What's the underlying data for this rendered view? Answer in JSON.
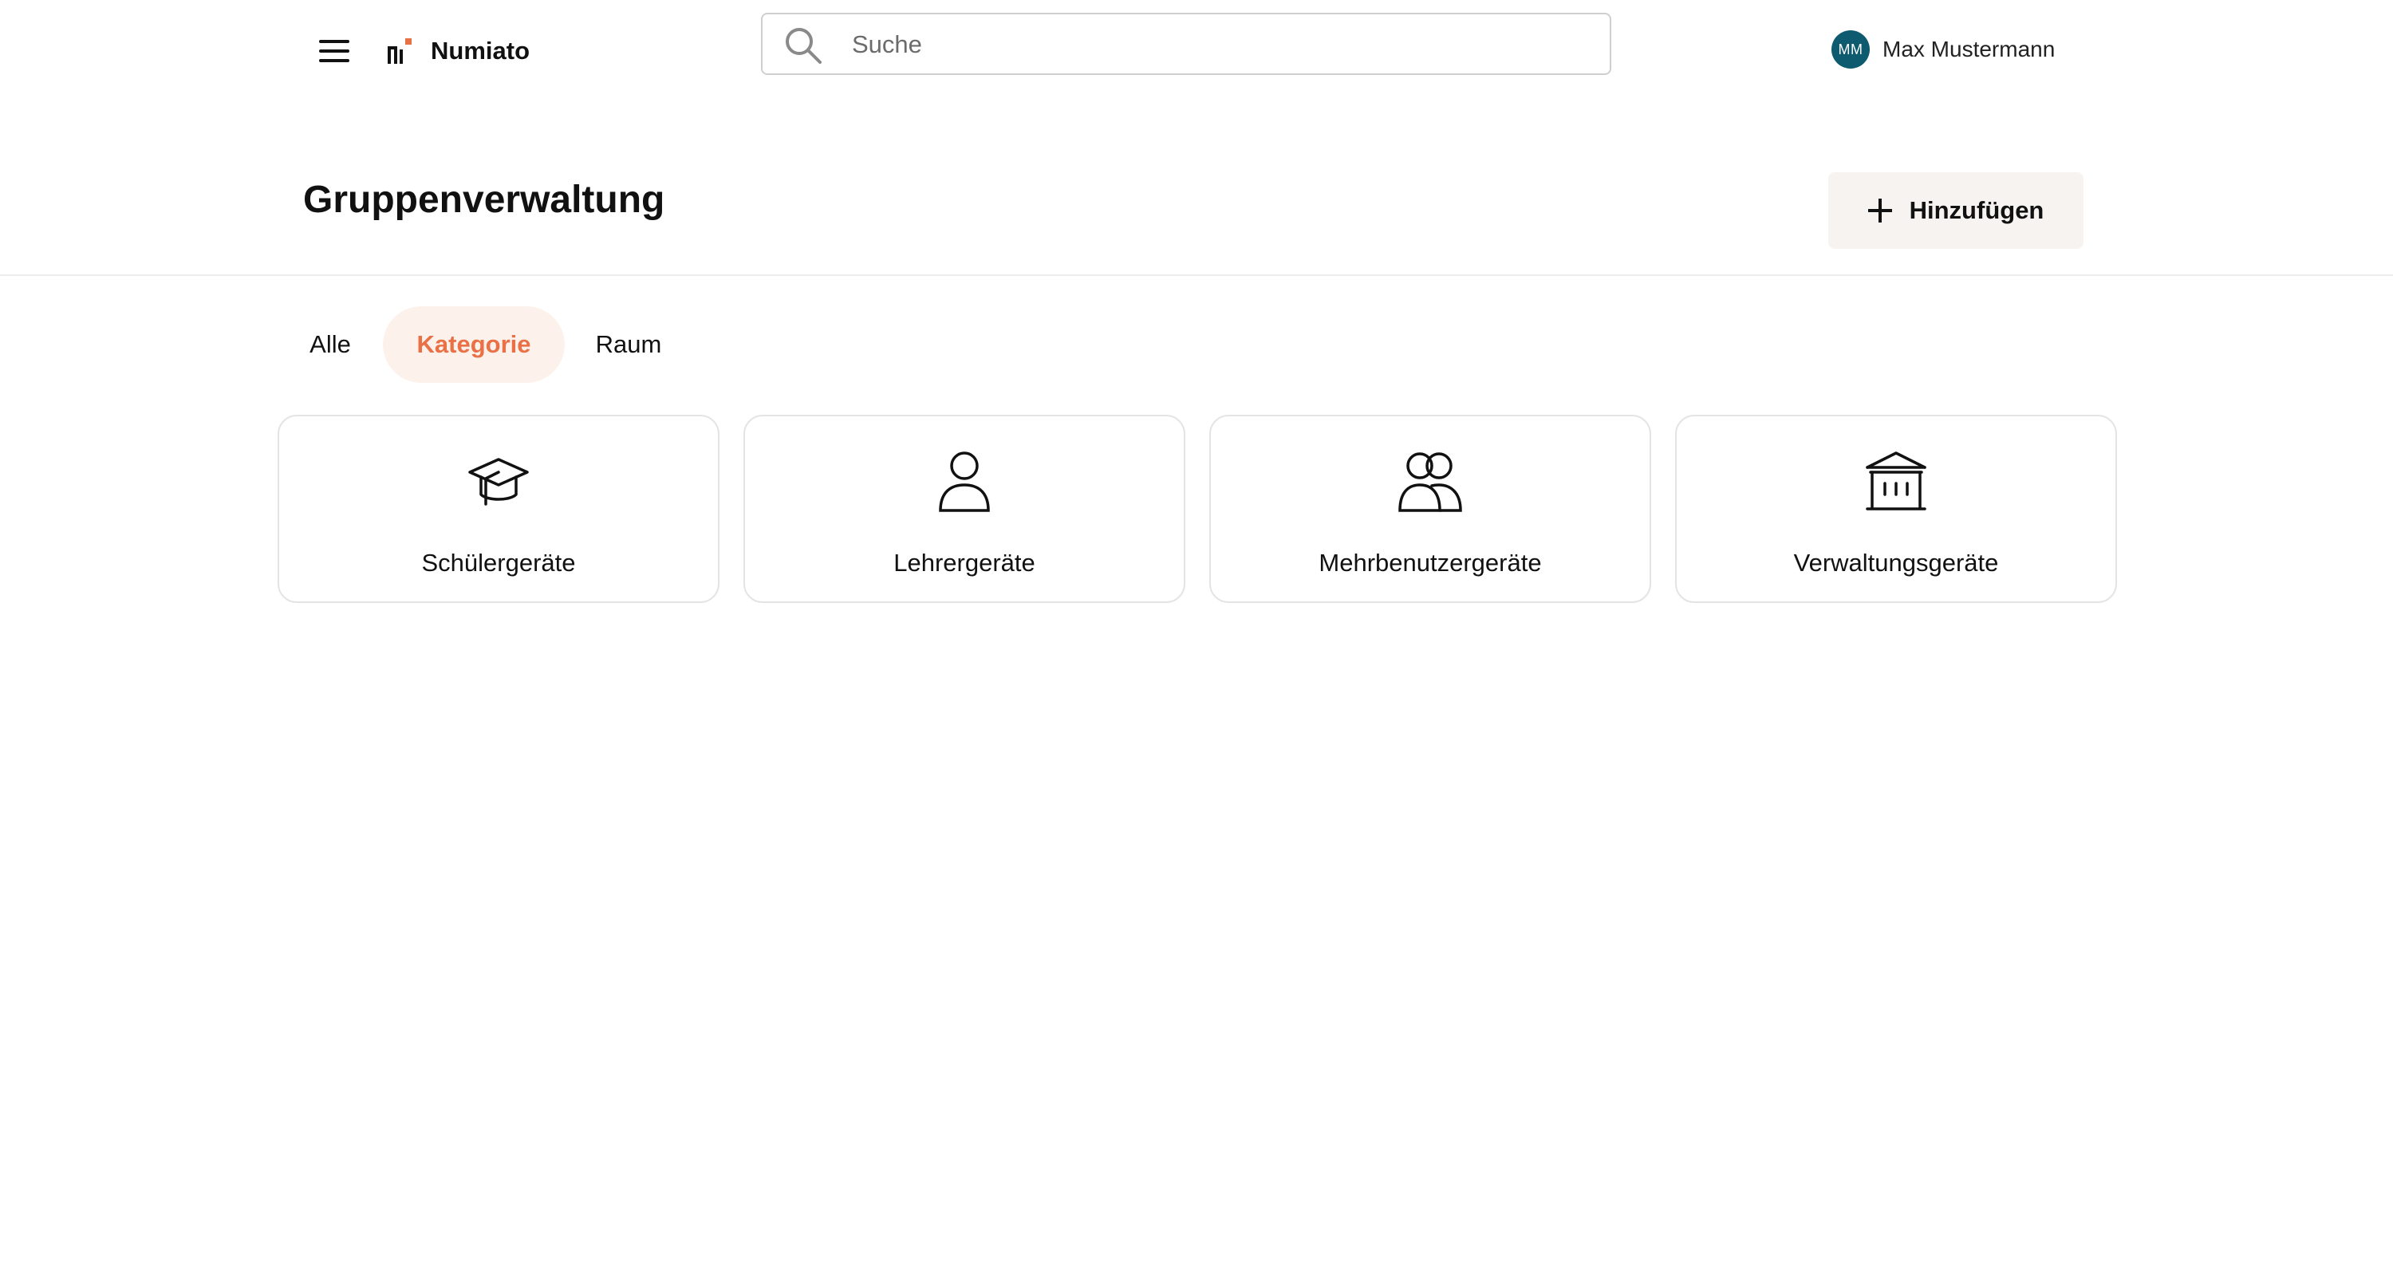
{
  "app": {
    "brand": "Numiato",
    "brand_accent_color": "#ea7045"
  },
  "search": {
    "placeholder": "Suche",
    "icon": "search-icon"
  },
  "user": {
    "initials": "MM",
    "name": "Max Mustermann",
    "avatar_color": "#0e5a6e"
  },
  "header": {
    "title": "Gruppenverwaltung",
    "add_label": "Hinzufügen"
  },
  "tabs": [
    {
      "label": "Alle",
      "active": false
    },
    {
      "label": "Kategorie",
      "active": true
    },
    {
      "label": "Raum",
      "active": false
    }
  ],
  "categories": [
    {
      "label": "Schülergeräte",
      "icon": "graduation-cap-icon"
    },
    {
      "label": "Lehrergeräte",
      "icon": "user-icon"
    },
    {
      "label": "Mehrbenutzergeräte",
      "icon": "users-icon"
    },
    {
      "label": "Verwaltungsgeräte",
      "icon": "building-icon"
    }
  ]
}
